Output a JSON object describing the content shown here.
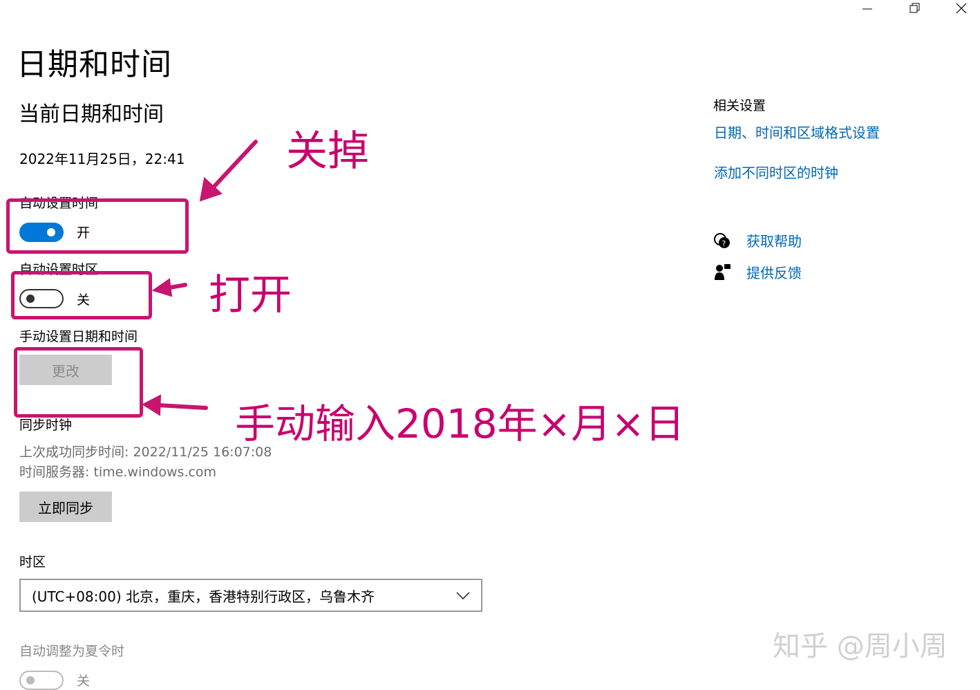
{
  "window": {
    "minimize_icon": "minimize-icon",
    "restore_icon": "restore-icon",
    "close_icon": "close-icon"
  },
  "page_title": "日期和时间",
  "current": {
    "heading": "当前日期和时间",
    "datetime": "2022年11月25日，22:41"
  },
  "auto_time": {
    "label": "自动设置时间",
    "state_label": "开",
    "on": true
  },
  "auto_timezone": {
    "label": "自动设置时区",
    "state_label": "关",
    "on": false
  },
  "manual": {
    "label": "手动设置日期和时间",
    "button_label": "更改"
  },
  "sync": {
    "heading": "同步时钟",
    "last_sync": "上次成功同步时间: 2022/11/25 16:07:08",
    "server": "时间服务器: time.windows.com",
    "button_label": "立即同步"
  },
  "timezone": {
    "label": "时区",
    "selected": "(UTC+08:00) 北京，重庆，香港特别行政区，乌鲁木齐"
  },
  "dst": {
    "label": "自动调整为夏令时",
    "state_label": "关",
    "on": false
  },
  "related": {
    "heading": "相关设置",
    "links": [
      "日期、时间和区域格式设置",
      "添加不同时区的时钟"
    ]
  },
  "help": {
    "get_help": "获取帮助",
    "feedback": "提供反馈"
  },
  "annotations": {
    "turn_off": "关掉",
    "turn_on": "打开",
    "manual_input": "手动输入2018年×月×日",
    "color": "#c8006e"
  },
  "watermark": "知乎 @周小周",
  "colors": {
    "accent": "#0078d7",
    "link": "#0067b8",
    "annotation": "#c8156f"
  }
}
